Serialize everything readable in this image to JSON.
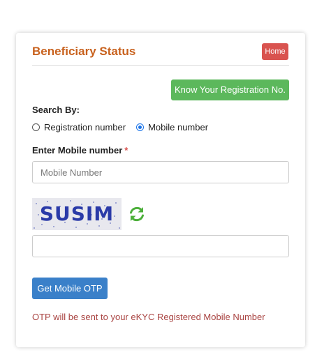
{
  "header": {
    "title": "Beneficiary Status",
    "home_label": "Home"
  },
  "know_button_label": "Know Your Registration No.",
  "search": {
    "label": "Search By:",
    "options": [
      {
        "label": "Registration number",
        "checked": false
      },
      {
        "label": "Mobile number",
        "checked": true
      }
    ]
  },
  "mobile": {
    "label": "Enter Mobile number",
    "required_mark": "*",
    "placeholder": "Mobile Number",
    "value": ""
  },
  "captcha": {
    "text": "SUSIM",
    "refresh_icon": "refresh-icon",
    "input_value": ""
  },
  "otp_button_label": "Get Mobile OTP",
  "note": "OTP will be sent to your eKYC Registered Mobile Number",
  "colors": {
    "title": "#c8611d",
    "home_button": "#d9534f",
    "know_button": "#5cb85c",
    "otp_button": "#3a80c9",
    "note": "#a94442",
    "refresh_icon": "#4caf3a"
  }
}
